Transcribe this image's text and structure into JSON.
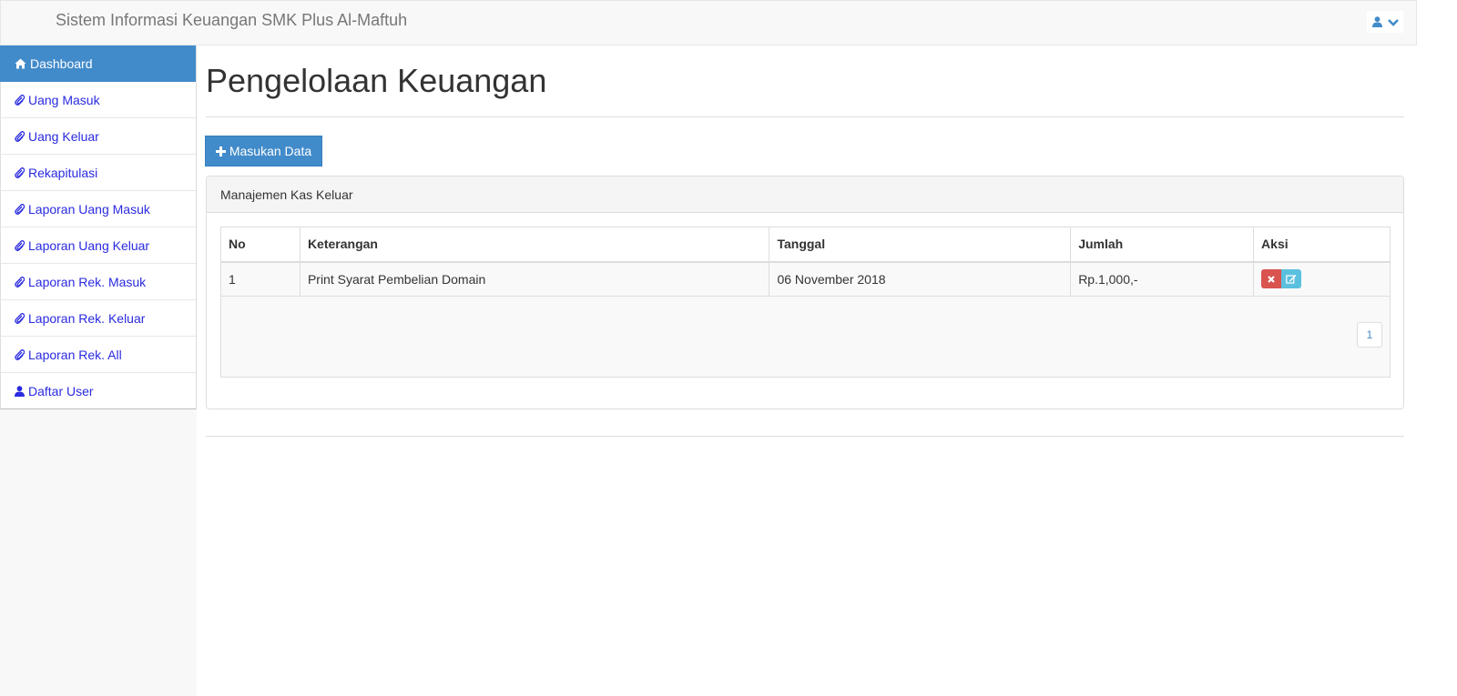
{
  "header": {
    "brand": "Sistem Informasi Keuangan SMK Plus Al-Maftuh",
    "user_icon": "user-icon",
    "caret_icon": "chevron-down-icon"
  },
  "sidebar": {
    "items": [
      {
        "label": "Dashboard",
        "icon": "home-icon",
        "active": true
      },
      {
        "label": "Uang Masuk",
        "icon": "paperclip-icon"
      },
      {
        "label": "Uang Keluar",
        "icon": "paperclip-icon"
      },
      {
        "label": "Rekapitulasi",
        "icon": "paperclip-icon"
      },
      {
        "label": "Laporan Uang Masuk",
        "icon": "paperclip-icon"
      },
      {
        "label": "Laporan Uang Keluar",
        "icon": "paperclip-icon"
      },
      {
        "label": "Laporan Rek. Masuk",
        "icon": "paperclip-icon"
      },
      {
        "label": "Laporan Rek. Keluar",
        "icon": "paperclip-icon"
      },
      {
        "label": "Laporan Rek. All",
        "icon": "paperclip-icon"
      },
      {
        "label": "Daftar User",
        "icon": "user-icon"
      }
    ]
  },
  "main": {
    "title": "Pengelolaan Keuangan",
    "add_button": "Masukan Data",
    "panel_title": "Manajemen Kas Keluar",
    "table": {
      "headers": [
        "No",
        "Keterangan",
        "Tanggal",
        "Jumlah",
        "Aksi"
      ],
      "rows": [
        {
          "no": "1",
          "keterangan": "Print Syarat Pembelian Domain",
          "tanggal": "06 November 2018",
          "jumlah": "Rp.1,000,-"
        }
      ]
    },
    "pagination": {
      "current": "1"
    }
  },
  "colors": {
    "primary": "#428bca",
    "danger": "#d9534f",
    "info": "#5bc0de",
    "link": "#2a2ae0"
  }
}
